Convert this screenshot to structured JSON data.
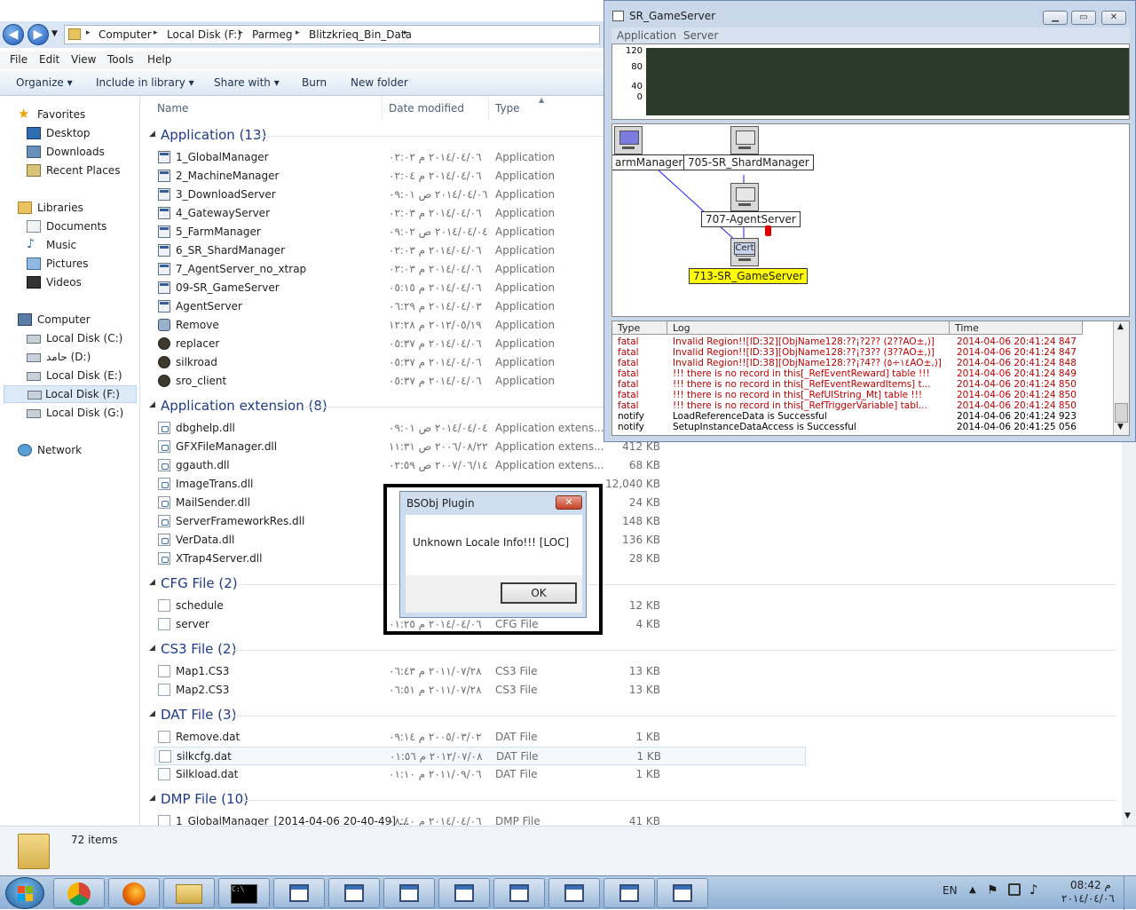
{
  "explorer": {
    "breadcrumbs": [
      "Computer",
      "Local Disk (F:)",
      "Parmeg",
      "Blitzkrieq_Bin_Data"
    ],
    "menu": [
      "File",
      "Edit",
      "View",
      "Tools",
      "Help"
    ],
    "commands": [
      "Organize",
      "Include in library",
      "Share with",
      "Burn",
      "New folder"
    ],
    "columns": {
      "name": "Name",
      "date": "Date modified",
      "type": "Type"
    },
    "nav": {
      "favorites": "Favorites",
      "favorite_items": [
        "Desktop",
        "Downloads",
        "Recent Places"
      ],
      "libraries": "Libraries",
      "library_items": [
        "Documents",
        "Music",
        "Pictures",
        "Videos"
      ],
      "computer": "Computer",
      "drives": [
        "Local Disk (C:)",
        "حامد (D:)",
        "Local Disk (E:)",
        "Local Disk (F:)",
        "Local Disk (G:)"
      ],
      "network": "Network"
    },
    "groups": [
      {
        "title": "Application (13)",
        "files": [
          {
            "name": "1_GlobalManager",
            "date": "٢٠١٤/٠٤/٠٦ م ٠٢:٠٢",
            "type": "Application",
            "size": ""
          },
          {
            "name": "2_MachineManager",
            "date": "٢٠١٤/٠٤/٠٦ م ٠٢:٠٤",
            "type": "Application",
            "size": ""
          },
          {
            "name": "3_DownloadServer",
            "date": "٢٠١٤/٠٤/٠٦ ص ٠٩:٠١",
            "type": "Application",
            "size": ""
          },
          {
            "name": "4_GatewayServer",
            "date": "٢٠١٤/٠٤/٠٦ م ٠٢:٠٣",
            "type": "Application",
            "size": ""
          },
          {
            "name": "5_FarmManager",
            "date": "٢٠١٤/٠٤/٠٤ ص ٠٩:٠٢",
            "type": "Application",
            "size": ""
          },
          {
            "name": "6_SR_ShardManager",
            "date": "٢٠١٤/٠٤/٠٦ م ٠٢:٠٣",
            "type": "Application",
            "size": ""
          },
          {
            "name": "7_AgentServer_no_xtrap",
            "date": "٢٠١٤/٠٤/٠٦ م ٠٢:٠٣",
            "type": "Application",
            "size": ""
          },
          {
            "name": "09-SR_GameServer",
            "date": "٢٠١٤/٠٤/٠٦ م ٠٥:١٥",
            "type": "Application",
            "size": ""
          },
          {
            "name": "AgentServer",
            "date": "٢٠١٤/٠٤/٠٣ م ٠٦:٢٩",
            "type": "Application",
            "size": ""
          },
          {
            "name": "Remove",
            "date": "٢٠١٢/٠٥/١٩ م ١٢:٢٨",
            "type": "Application",
            "size": ""
          },
          {
            "name": "replacer",
            "date": "٢٠١٤/٠٤/٠٦ م ٠٥:٣٧",
            "type": "Application",
            "size": ""
          },
          {
            "name": "silkroad",
            "date": "٢٠١٤/٠٤/٠٦ م ٠٥:٣٧",
            "type": "Application",
            "size": ""
          },
          {
            "name": "sro_client",
            "date": "٢٠١٤/٠٤/٠٦ م ٠٥:٣٧",
            "type": "Application",
            "size": ""
          }
        ]
      },
      {
        "title": "Application extension (8)",
        "files": [
          {
            "name": "dbghelp.dll",
            "date": "٢٠١٤/٠٤/٠٤ ص ٠٩:٠١",
            "type": "Application extens...",
            "size": ""
          },
          {
            "name": "GFXFileManager.dll",
            "date": "٢٠٠٦/٠٨/٢٢ ص ١١:٣١",
            "type": "Application extens...",
            "size": "412 KB"
          },
          {
            "name": "ggauth.dll",
            "date": "٢٠٠٧/٠٦/١٤ ص ٠٢:٥٩",
            "type": "Application extens...",
            "size": "68 KB"
          },
          {
            "name": "ImageTrans.dll",
            "date": "",
            "type": "",
            "size": "12,040 KB"
          },
          {
            "name": "MailSender.dll",
            "date": "",
            "type": "",
            "size": "24 KB"
          },
          {
            "name": "ServerFrameworkRes.dll",
            "date": "",
            "type": "",
            "size": "148 KB"
          },
          {
            "name": "VerData.dll",
            "date": "",
            "type": "",
            "size": "136 KB"
          },
          {
            "name": "XTrap4Server.dll",
            "date": "",
            "type": "",
            "size": "28 KB"
          }
        ]
      },
      {
        "title": "CFG File (2)",
        "files": [
          {
            "name": "schedule",
            "date": "",
            "type": "",
            "size": "12 KB"
          },
          {
            "name": "server",
            "date": "٢٠١٤/٠٤/٠٦ م ٠١:٢٥",
            "type": "CFG File",
            "size": "4 KB"
          }
        ]
      },
      {
        "title": "CS3 File (2)",
        "files": [
          {
            "name": "Map1.CS3",
            "date": "٢٠١١/٠٧/٢٨ م ٠٦:٤٣",
            "type": "CS3 File",
            "size": "13 KB"
          },
          {
            "name": "Map2.CS3",
            "date": "٢٠١١/٠٧/٢٨ م ٠٦:٥١",
            "type": "CS3 File",
            "size": "13 KB"
          }
        ]
      },
      {
        "title": "DAT File (3)",
        "files": [
          {
            "name": "Remove.dat",
            "date": "٢٠٠٥/٠٣/٠٢ م ٠٩:١٤",
            "type": "DAT File",
            "size": "1 KB"
          },
          {
            "name": "silkcfg.dat",
            "date": "٢٠١٢/٠٧/٠٨ م ٠١:٥٦",
            "type": "DAT File",
            "size": "1 KB"
          },
          {
            "name": "Silkload.dat",
            "date": "٢٠١١/٠٩/٠٦ م ٠١:١٠",
            "type": "DAT File",
            "size": "1 KB"
          }
        ]
      },
      {
        "title": "DMP File (10)",
        "files": [
          {
            "name": "1_GlobalManager_[2014-04-06 20-40-49] ...",
            "date": "٢٠١٤/٠٤/٠٦ م ٠٨:٤٠",
            "type": "DMP File",
            "size": "41 KB"
          }
        ]
      }
    ],
    "status": "72 items"
  },
  "gameserver": {
    "title": "SR_GameServer",
    "menu": [
      "Application",
      "Server"
    ],
    "chart_ticks": [
      "120",
      "80",
      "40",
      "0"
    ],
    "servers": {
      "farm": "armManager",
      "shard": "705-SR_ShardManager",
      "agent": "707-AgentServer",
      "cert": "Cert",
      "game": "713-SR_GameServer"
    },
    "log_headers": [
      "Type",
      "Log",
      "Time"
    ],
    "log": [
      {
        "type": "fatal",
        "log": "Invalid Region!![ID:32][ObjName128:??¡?2?? (2??AO±,)]",
        "time": "2014-04-06 20:41:24 847"
      },
      {
        "type": "fatal",
        "log": "Invalid Region!![ID:33][ObjName128:??¡?3?? (3??AO±,)]",
        "time": "2014-04-06 20:41:24 847"
      },
      {
        "type": "fatal",
        "log": "Invalid Region!![ID:38][ObjName128:??¡?4?? (١٤÷٥AO±,)]",
        "time": "2014-04-06 20:41:24 848"
      },
      {
        "type": "fatal",
        "log": "!!! there is no record in this[_RefEventReward] table !!!",
        "time": "2014-04-06 20:41:24 849"
      },
      {
        "type": "fatal",
        "log": "!!! there is no record in this[_RefEventRewardItems] t...",
        "time": "2014-04-06 20:41:24 850"
      },
      {
        "type": "fatal",
        "log": "!!! there is no record in this[_RefUIString_Mt] table !!!",
        "time": "2014-04-06 20:41:24 850"
      },
      {
        "type": "fatal",
        "log": "!!! there is no record in this[_RefTriggerVariable] tabl...",
        "time": "2014-04-06 20:41:24 850"
      },
      {
        "type": "notify",
        "log": "LoadReferenceData is Successful",
        "time": "2014-04-06 20:41:24 923"
      },
      {
        "type": "notify",
        "log": "SetupInstanceDataAccess is Successful",
        "time": "2014-04-06 20:41:25 056"
      }
    ]
  },
  "dialog": {
    "title": "BSObj Plugin",
    "message": "Unknown Locale Info!!! [LOC]",
    "ok": "OK"
  },
  "taskbar": {
    "lang": "EN",
    "time": "08:42 م",
    "date": "٢٠١٤/٠٤/٠٦"
  }
}
